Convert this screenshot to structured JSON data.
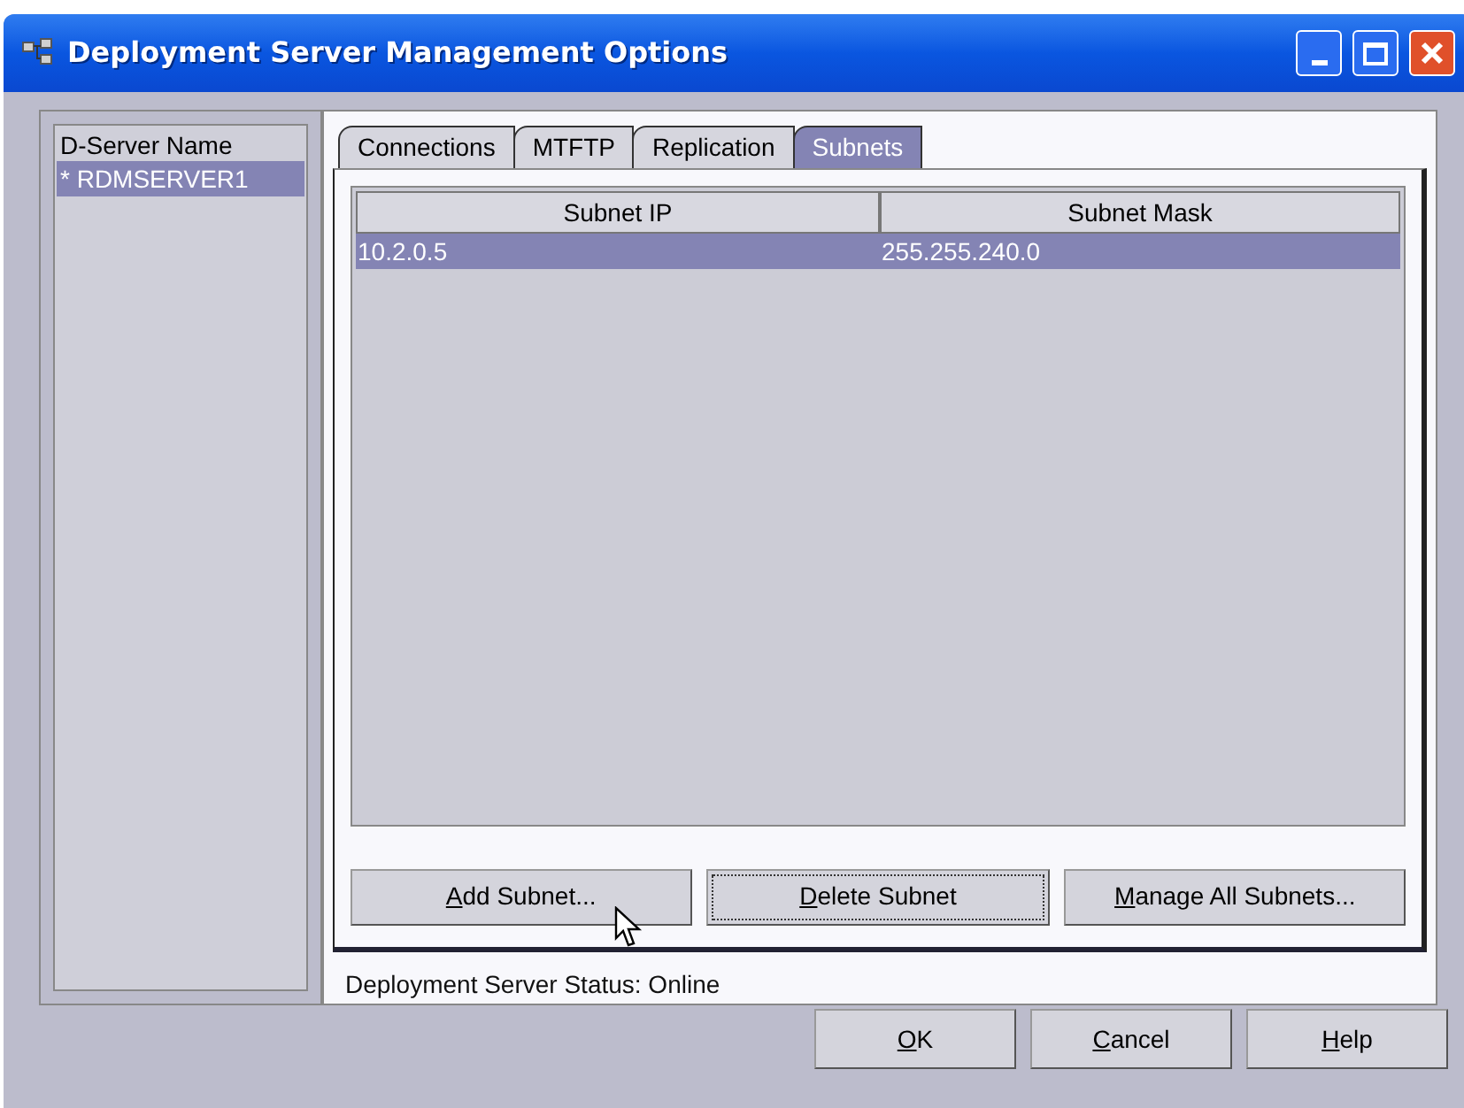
{
  "window": {
    "title": "Deployment Server Management Options"
  },
  "server_list": {
    "header": "D-Server Name",
    "items": [
      {
        "label": "* RDMSERVER1",
        "selected": true
      }
    ]
  },
  "tabs": [
    {
      "label": "Connections",
      "selected": false
    },
    {
      "label": "MTFTP",
      "selected": false
    },
    {
      "label": "Replication",
      "selected": false
    },
    {
      "label": "Subnets",
      "selected": true
    }
  ],
  "table": {
    "columns": [
      "Subnet IP",
      "Subnet Mask"
    ],
    "rows": [
      {
        "cells": [
          "10.2.0.5",
          "255.255.240.0"
        ],
        "selected": true
      }
    ]
  },
  "panel_buttons": [
    {
      "label": "Add Subnet...",
      "mnemonic_underlined": true,
      "focused": false
    },
    {
      "label": "Delete Subnet",
      "mnemonic_underlined": true,
      "focused": true
    },
    {
      "label": "Manage All Subnets...",
      "mnemonic_underlined": true,
      "focused": false
    }
  ],
  "status": "Deployment Server Status: Online",
  "dialog_buttons": [
    {
      "label": "OK",
      "mnemonic_underlined": true
    },
    {
      "label": "Cancel",
      "mnemonic_underlined": true
    },
    {
      "label": "Help",
      "mnemonic_underlined": true
    }
  ]
}
